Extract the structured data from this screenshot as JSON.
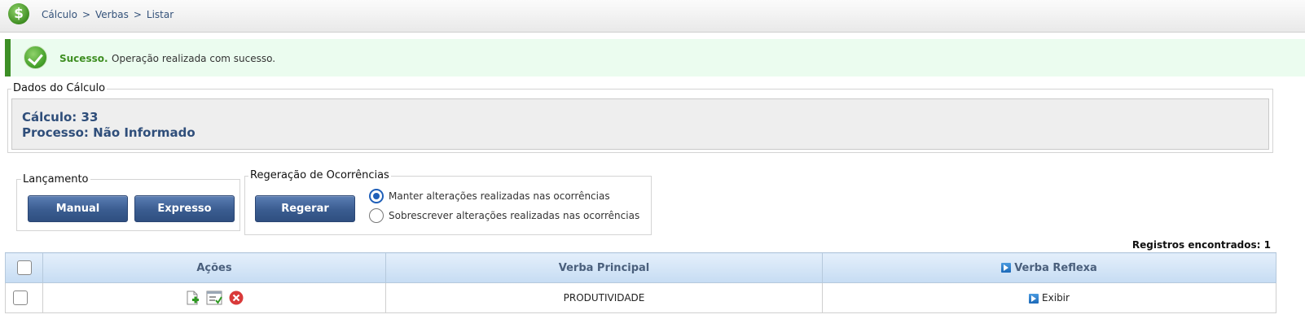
{
  "header": {
    "logo_symbol": "$",
    "breadcrumb": [
      "Cálculo",
      "Verbas",
      "Listar"
    ],
    "separator": ">"
  },
  "alert": {
    "title": "Sucesso.",
    "message": "Operação realizada com sucesso.",
    "icon": "check-circle-icon"
  },
  "dados": {
    "legend": "Dados do Cálculo",
    "calculo": "Cálculo: 33",
    "processo": "Processo: Não Informado"
  },
  "lancamento": {
    "legend": "Lançamento",
    "manual_label": "Manual",
    "expresso_label": "Expresso"
  },
  "regeracao": {
    "legend": "Regeração de Ocorrências",
    "regerar_label": "Regerar",
    "options": [
      {
        "label": "Manter alterações realizadas nas ocorrências",
        "selected": true
      },
      {
        "label": "Sobrescrever alterações realizadas nas ocorrências",
        "selected": false
      }
    ]
  },
  "records": "Registros encontrados: 1",
  "table": {
    "headers": [
      "Ações",
      "Verba Principal",
      "Verba Reflexa"
    ],
    "rows": [
      {
        "verba_principal": "PRODUTIVIDADE",
        "verba_reflexa": "Exibir"
      }
    ]
  },
  "colors": {
    "accent": "#3a5c90",
    "success": "#3e8e22",
    "success_bg": "#ebfcef"
  }
}
